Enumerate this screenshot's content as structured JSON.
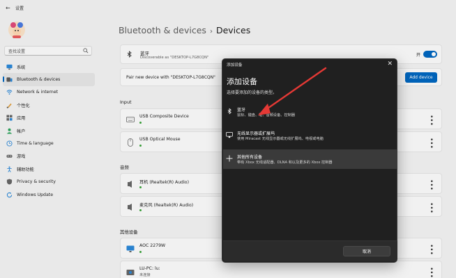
{
  "window": {
    "title": "设置"
  },
  "sidebar": {
    "search_placeholder": "查找设置",
    "items": [
      {
        "label": "系统",
        "icon": "monitor-icon",
        "active": false
      },
      {
        "label": "Bluetooth & devices",
        "icon": "bluetooth-devices-icon",
        "active": true
      },
      {
        "label": "Network & internet",
        "icon": "wifi-icon",
        "active": false
      },
      {
        "label": "个性化",
        "icon": "brush-icon",
        "active": false
      },
      {
        "label": "应用",
        "icon": "apps-icon",
        "active": false
      },
      {
        "label": "帐户",
        "icon": "person-icon",
        "active": false
      },
      {
        "label": "Time & language",
        "icon": "globe-clock-icon",
        "active": false
      },
      {
        "label": "游戏",
        "icon": "gamepad-icon",
        "active": false
      },
      {
        "label": "辅助功能",
        "icon": "accessibility-icon",
        "active": false
      },
      {
        "label": "Privacy & security",
        "icon": "shield-icon",
        "active": false
      },
      {
        "label": "Windows Update",
        "icon": "update-icon",
        "active": false
      }
    ]
  },
  "breadcrumb": {
    "parent": "Bluetooth & devices",
    "sep": "›",
    "current": "Devices"
  },
  "bluetooth": {
    "name": "蓝牙",
    "sub": "Discoverable as \"DESKTOP-L7G8CQN\"",
    "state_label": "开"
  },
  "pair": {
    "text": "Pair new device with \"DESKTOP-L7G8CQN\"",
    "button": "Add device"
  },
  "sections": {
    "input": "Input",
    "audio": "音频",
    "other": "其他设备"
  },
  "devices": {
    "input": [
      {
        "name": "USB Composite Device",
        "icon": "keyboard-icon"
      },
      {
        "name": "USB Optical Mouse",
        "icon": "mouse-icon"
      }
    ],
    "audio": [
      {
        "name": "耳机 (Realtek(R) Audio)",
        "icon": "speaker-icon"
      },
      {
        "name": "麦克风 (Realtek(R) Audio)",
        "icon": "speaker-icon"
      }
    ],
    "other": [
      {
        "name": "AOC 2279W",
        "icon": "monitor-icon",
        "sub": ""
      },
      {
        "name": "LU-PC: lu:",
        "icon": "media-device-icon",
        "sub": "未连接"
      }
    ]
  },
  "dialog": {
    "title": "添加设备",
    "close": "✕",
    "heading": "添加设备",
    "subheading": "选择要添加的设备的类型。",
    "options": [
      {
        "name": "蓝牙",
        "desc": "鼠标、键盘、笔、音频设备、控制器",
        "icon": "bluetooth-icon"
      },
      {
        "name": "无线显示器或扩展坞",
        "desc": "使用 Miracast 无线显示器或无线扩展坞、电视或电脑",
        "icon": "monitor-icon"
      },
      {
        "name": "其他所有设备",
        "desc": "带有 Xbox 无线适配器、DLNA 和以及更多的 Xbox 控制器",
        "icon": "plus-icon"
      }
    ],
    "cancel": "取消"
  },
  "colors": {
    "accent": "#0067c0",
    "dialog_bg": "#202020",
    "arrow": "#e53935"
  }
}
